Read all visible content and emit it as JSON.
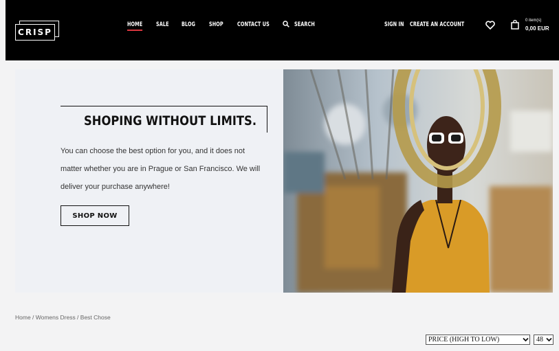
{
  "header": {
    "logo_text": "CRISP",
    "nav": [
      {
        "label": "HOME",
        "active": true
      },
      {
        "label": "SALE"
      },
      {
        "label": "BLOG"
      },
      {
        "label": "SHOP"
      },
      {
        "label": "CONTACT US"
      }
    ],
    "search_label": "SEARCH",
    "sign_in": "SIGN IN",
    "create_account": "CREATE AN ACCOUNT",
    "wishlist_icon": "heart-icon",
    "cart_icon": "shopping-bag-icon",
    "cart_items": "0 item(s)",
    "cart_total": "0,00 EUR",
    "accent_color": "#d9363e"
  },
  "hero": {
    "headline": "SHOPING WITHOUT LIMITS.",
    "description": "You can choose the best option for you, and it does not matter whether you are in Prague or San Francisco. We will deliver your purchase anywhere!",
    "button_label": "SHOP NOW"
  },
  "breadcrumb": "Home / Womens Dress / Best Chose",
  "sorting": {
    "sort_value": "PRICE (HIGH TO LOW)",
    "per_page_value": "48"
  }
}
